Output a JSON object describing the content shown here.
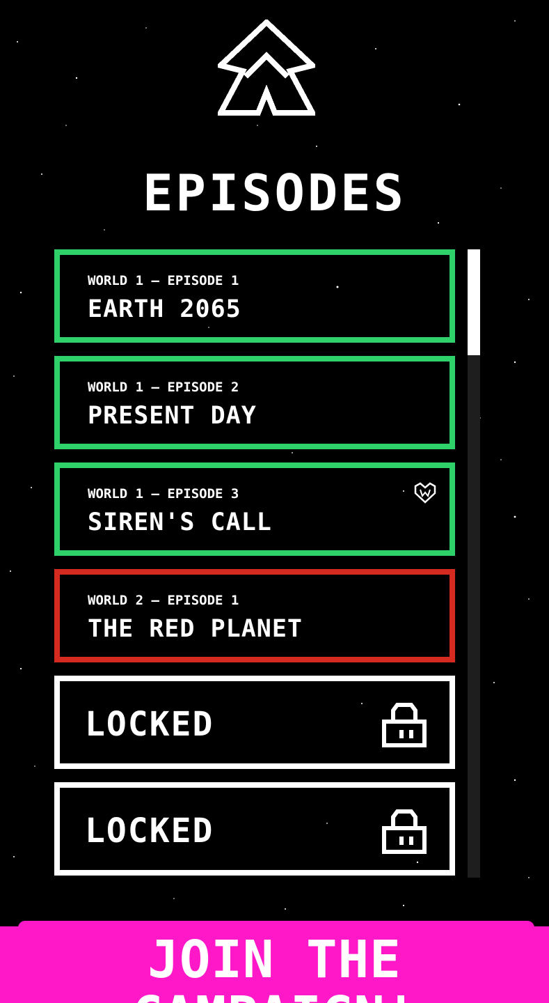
{
  "screen": {
    "title": "EPISODES"
  },
  "episodes": [
    {
      "subtitle": "WORLD 1 – EPISODE 1",
      "name": "EARTH 2065",
      "color": "#2fd16a",
      "badge": ""
    },
    {
      "subtitle": "WORLD 1 – EPISODE 2",
      "name": "PRESENT DAY",
      "color": "#2fd16a",
      "badge": ""
    },
    {
      "subtitle": "WORLD 1 – EPISODE 3",
      "name": "SIREN'S CALL",
      "color": "#2fd16a",
      "badge": "heart-badge-icon"
    },
    {
      "subtitle": "WORLD 2 – EPISODE 1",
      "name": "THE RED PLANET",
      "color": "#d42a1f",
      "badge": ""
    }
  ],
  "locked_slots": [
    {
      "label": "LOCKED",
      "icon": "padlock-icon",
      "color": "#ffffff"
    },
    {
      "label": "LOCKED",
      "icon": "padlock-icon",
      "color": "#ffffff"
    }
  ],
  "cta": {
    "label": "JOIN THE CAMPAIGN!",
    "color": "#ff18c8"
  },
  "logo": {
    "icon": "meeple-logo-icon"
  },
  "scrollbar": {
    "position": 0
  }
}
